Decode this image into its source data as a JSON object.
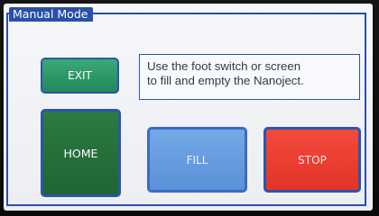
{
  "window": {
    "title": "Manual Mode"
  },
  "buttons": {
    "exit_label": "EXIT",
    "home_label": "HOME",
    "fill_label": "FILL",
    "stop_label": "STOP"
  },
  "info": {
    "line1": "Use the foot switch or screen",
    "line2": "to fill and empty the Nanoject."
  },
  "colors": {
    "frame": "#2a4fa8",
    "exit": "#2c9a68",
    "home": "#23703b",
    "fill": "#6a9fe0",
    "stop": "#ea3f33"
  }
}
